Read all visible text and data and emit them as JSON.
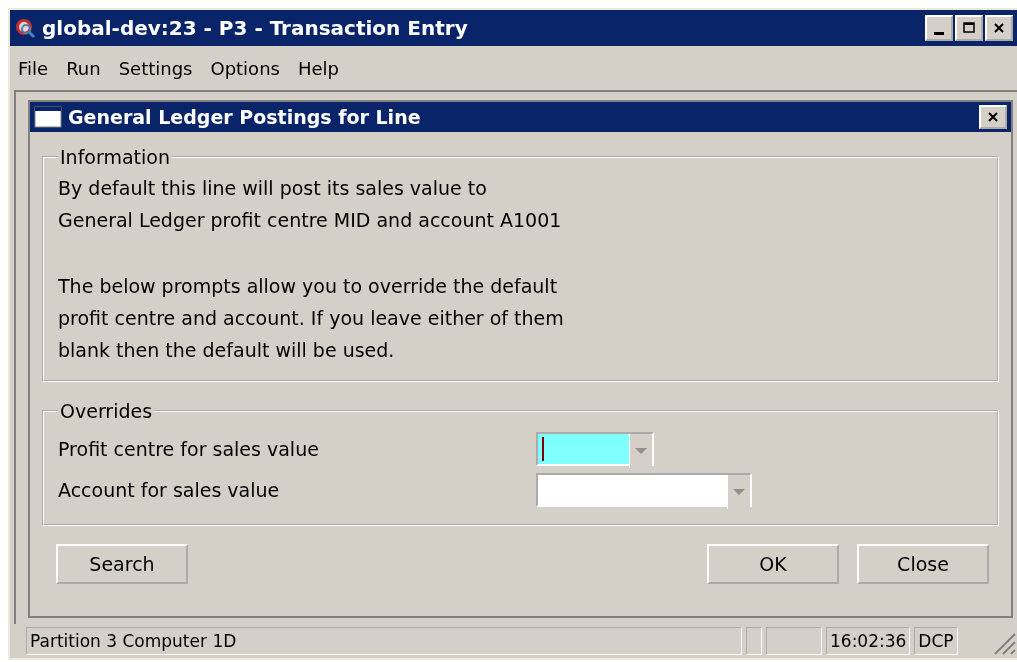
{
  "window": {
    "title": "global-dev:23 - P3 - Transaction Entry"
  },
  "menu": [
    "File",
    "Run",
    "Settings",
    "Options",
    "Help"
  ],
  "dialog": {
    "title": "General Ledger Postings for Line",
    "information": {
      "legend": "Information",
      "paragraphs": [
        [
          "By default this line will post its sales value to",
          "General Ledger profit centre MID  and account A1001"
        ],
        [
          "The below prompts allow you to override the default",
          "profit centre and account.  If you leave either of them",
          "blank then the default will be used."
        ]
      ]
    },
    "overrides": {
      "legend": "Overrides",
      "fields": [
        {
          "label": "Profit centre for sales value",
          "focused": true
        },
        {
          "label": "Account for sales value",
          "focused": false
        }
      ]
    },
    "buttons": {
      "left": [
        "Search"
      ],
      "right": [
        "OK",
        "Close"
      ]
    }
  },
  "status_bar": [
    {
      "text": "Partition 3 Computer 1D",
      "kind": "wide"
    },
    {
      "kind": "tiny"
    },
    {
      "kind": "small"
    },
    {
      "text": "16:02:36",
      "kind": "normal"
    },
    {
      "text": "DCP",
      "kind": "normal"
    }
  ]
}
